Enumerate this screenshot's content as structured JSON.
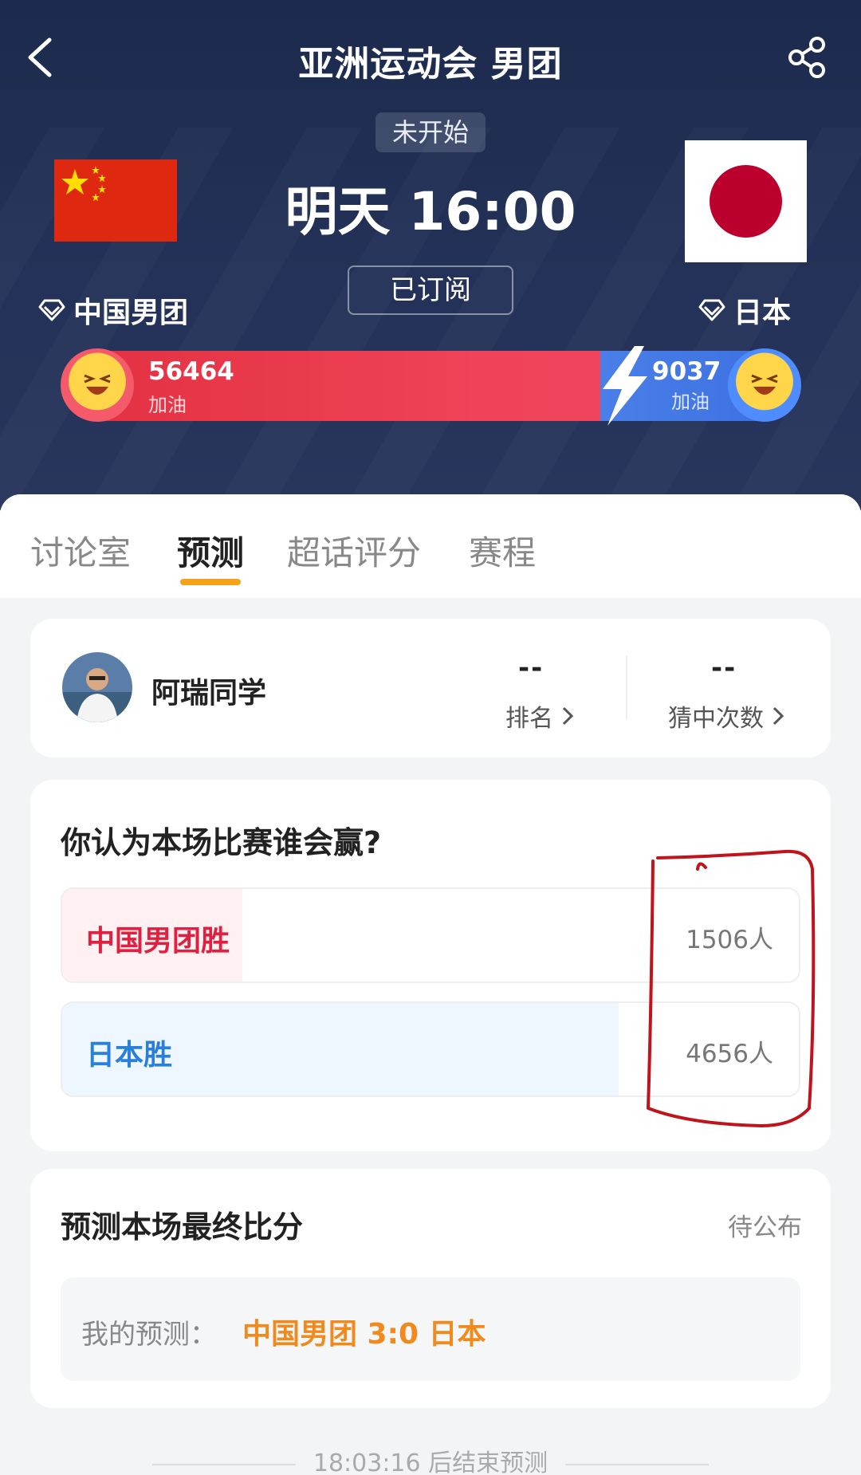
{
  "header": {
    "title": "亚洲运动会 男团",
    "status": "未开始",
    "match_time": "明天 16:00",
    "subscribe_label": "已订阅",
    "team_left": "中国男团",
    "team_right": "日本"
  },
  "cheer": {
    "left_count": "56464",
    "left_label": "加油",
    "right_count": "9037",
    "right_label": "加油"
  },
  "tabs": [
    "讨论室",
    "预测",
    "超话评分",
    "赛程"
  ],
  "user": {
    "name": "阿瑞同学",
    "rank_value": "--",
    "rank_label": "排名",
    "hits_value": "--",
    "hits_label": "猜中次数"
  },
  "vote": {
    "question": "你认为本场比赛谁会赢?",
    "options": [
      {
        "label": "中国男团胜",
        "count": "1506人",
        "share": 0.245,
        "color": "#e02040",
        "fill": "#fff0f2"
      },
      {
        "label": "日本胜",
        "count": "4656人",
        "share": 0.755,
        "color": "#2a7fd9",
        "fill": "#eef6ff"
      }
    ]
  },
  "score": {
    "title": "预测本场最终比分",
    "status": "待公布",
    "my_label": "我的预测：",
    "my_value": "中国男团 3:0 日本"
  },
  "footer": "18:03:16 后结束预测"
}
